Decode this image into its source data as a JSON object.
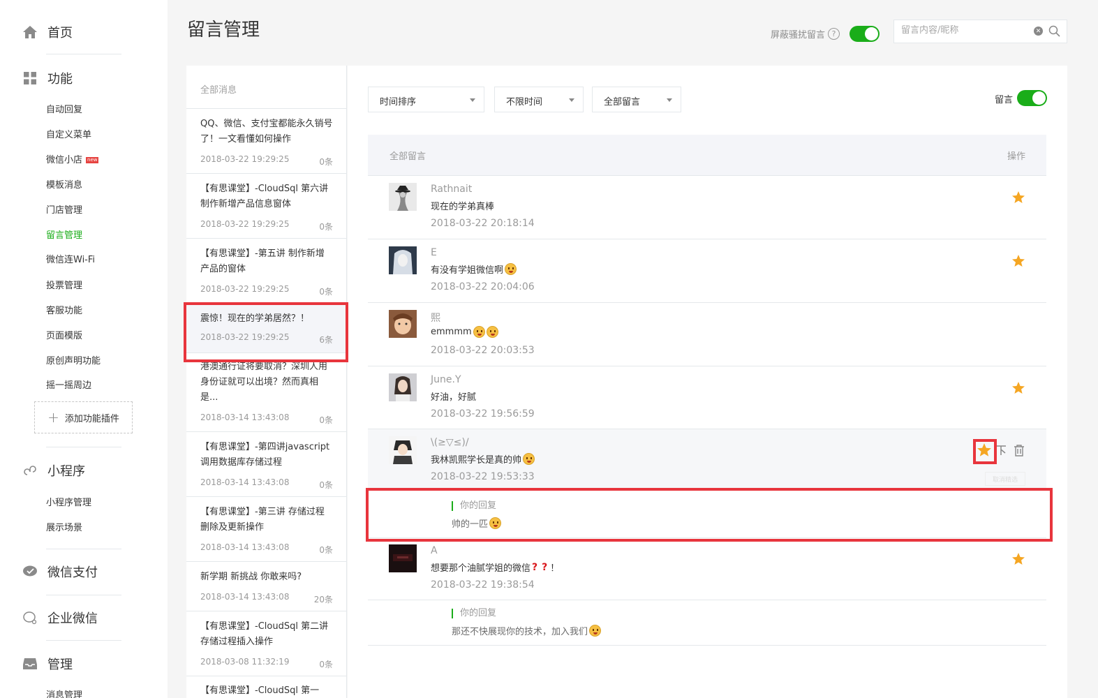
{
  "nav": {
    "home": "首页",
    "functions": {
      "title": "功能",
      "items": [
        "自动回复",
        "自定义菜单",
        "微信小店",
        "模板消息",
        "门店管理",
        "留言管理",
        "微信连Wi-Fi",
        "投票管理",
        "客服功能",
        "页面模版",
        "原创声明功能",
        "摇一摇周边"
      ],
      "new_badge": "new",
      "add_plugin": "添加功能插件"
    },
    "miniprogram": {
      "title": "小程序",
      "items": [
        "小程序管理",
        "展示场景"
      ]
    },
    "pay": "微信支付",
    "work": "企业微信",
    "manage": {
      "title": "管理",
      "items": [
        "消息管理"
      ]
    }
  },
  "header": {
    "title": "留言管理",
    "block_label": "屏蔽骚扰留言",
    "help": "?",
    "search_placeholder": "留言内容/昵称"
  },
  "message_list": {
    "header": "全部消息",
    "items": [
      {
        "title": "QQ、微信、支付宝都能永久销号了！一文看懂如何操作",
        "date": "2018-03-22 19:29:25",
        "count": "0条"
      },
      {
        "title": "【有思课堂】-CloudSql 第六讲 制作新增产品信息窗体",
        "date": "2018-03-22 19:29:25",
        "count": "0条"
      },
      {
        "title": "【有思课堂】-第五讲 制作新增产品的窗体",
        "date": "2018-03-22 19:29:25",
        "count": "0条"
      },
      {
        "title": "震惊！现在的学弟居然？！",
        "date": "2018-03-22 19:29:25",
        "count": "6条"
      },
      {
        "title": "港澳通行证将要取消？深圳人用身份证就可以出境？然而真相是...",
        "date": "2018-03-14 13:43:08",
        "count": "0条"
      },
      {
        "title": "【有思课堂】-第四讲javascript调用数据库存储过程",
        "date": "2018-03-14 13:43:08",
        "count": "0条"
      },
      {
        "title": "【有思课堂】-第三讲 存储过程删除及更新操作",
        "date": "2018-03-14 13:43:08",
        "count": "0条"
      },
      {
        "title": "新学期 新挑战 你敢来吗?",
        "date": "2018-03-14 13:43:08",
        "count": "20条"
      },
      {
        "title": "【有思课堂】-CloudSql 第二讲 存储过程插入操作",
        "date": "2018-03-08 11:32:19",
        "count": "0条"
      },
      {
        "title": "【有思课堂】-CloudSql 第一",
        "date": "",
        "count": ""
      }
    ]
  },
  "filters": {
    "sort": "时间排序",
    "time": "不限时间",
    "type": "全部留言",
    "reply_toggle_label": "留言"
  },
  "table": {
    "col_all": "全部留言",
    "col_op": "操作"
  },
  "comments": [
    {
      "name": "Rathnait",
      "text": "现在的学弟真棒",
      "time": "2018-03-22 20:18:14"
    },
    {
      "name": "E",
      "text": "有没有学姐微信啊",
      "time": "2018-03-22 20:04:06"
    },
    {
      "name": "熙",
      "text": "emmmm",
      "time": "2018-03-22 20:03:53"
    },
    {
      "name": "June.Y",
      "text": "好油，好腻",
      "time": "2018-03-22 19:56:59"
    },
    {
      "name": "\\(≥▽≤)/",
      "text": "我林凯熙学长是真的帅",
      "time": "2018-03-22 19:53:33",
      "reply_label": "你的回复",
      "reply_text": "帅的一匹",
      "tooltip": "取消精选"
    },
    {
      "name": "A",
      "text": "想要那个油腻学姐的微信",
      "text_suffix": "！",
      "time": "2018-03-22 19:38:54",
      "reply_label": "你的回复",
      "reply_text": "那还不快展现你的技术，加入我们"
    }
  ],
  "colors": {
    "accent": "#1aad19",
    "highlight": "#e8353d",
    "star": "#f5a623"
  }
}
